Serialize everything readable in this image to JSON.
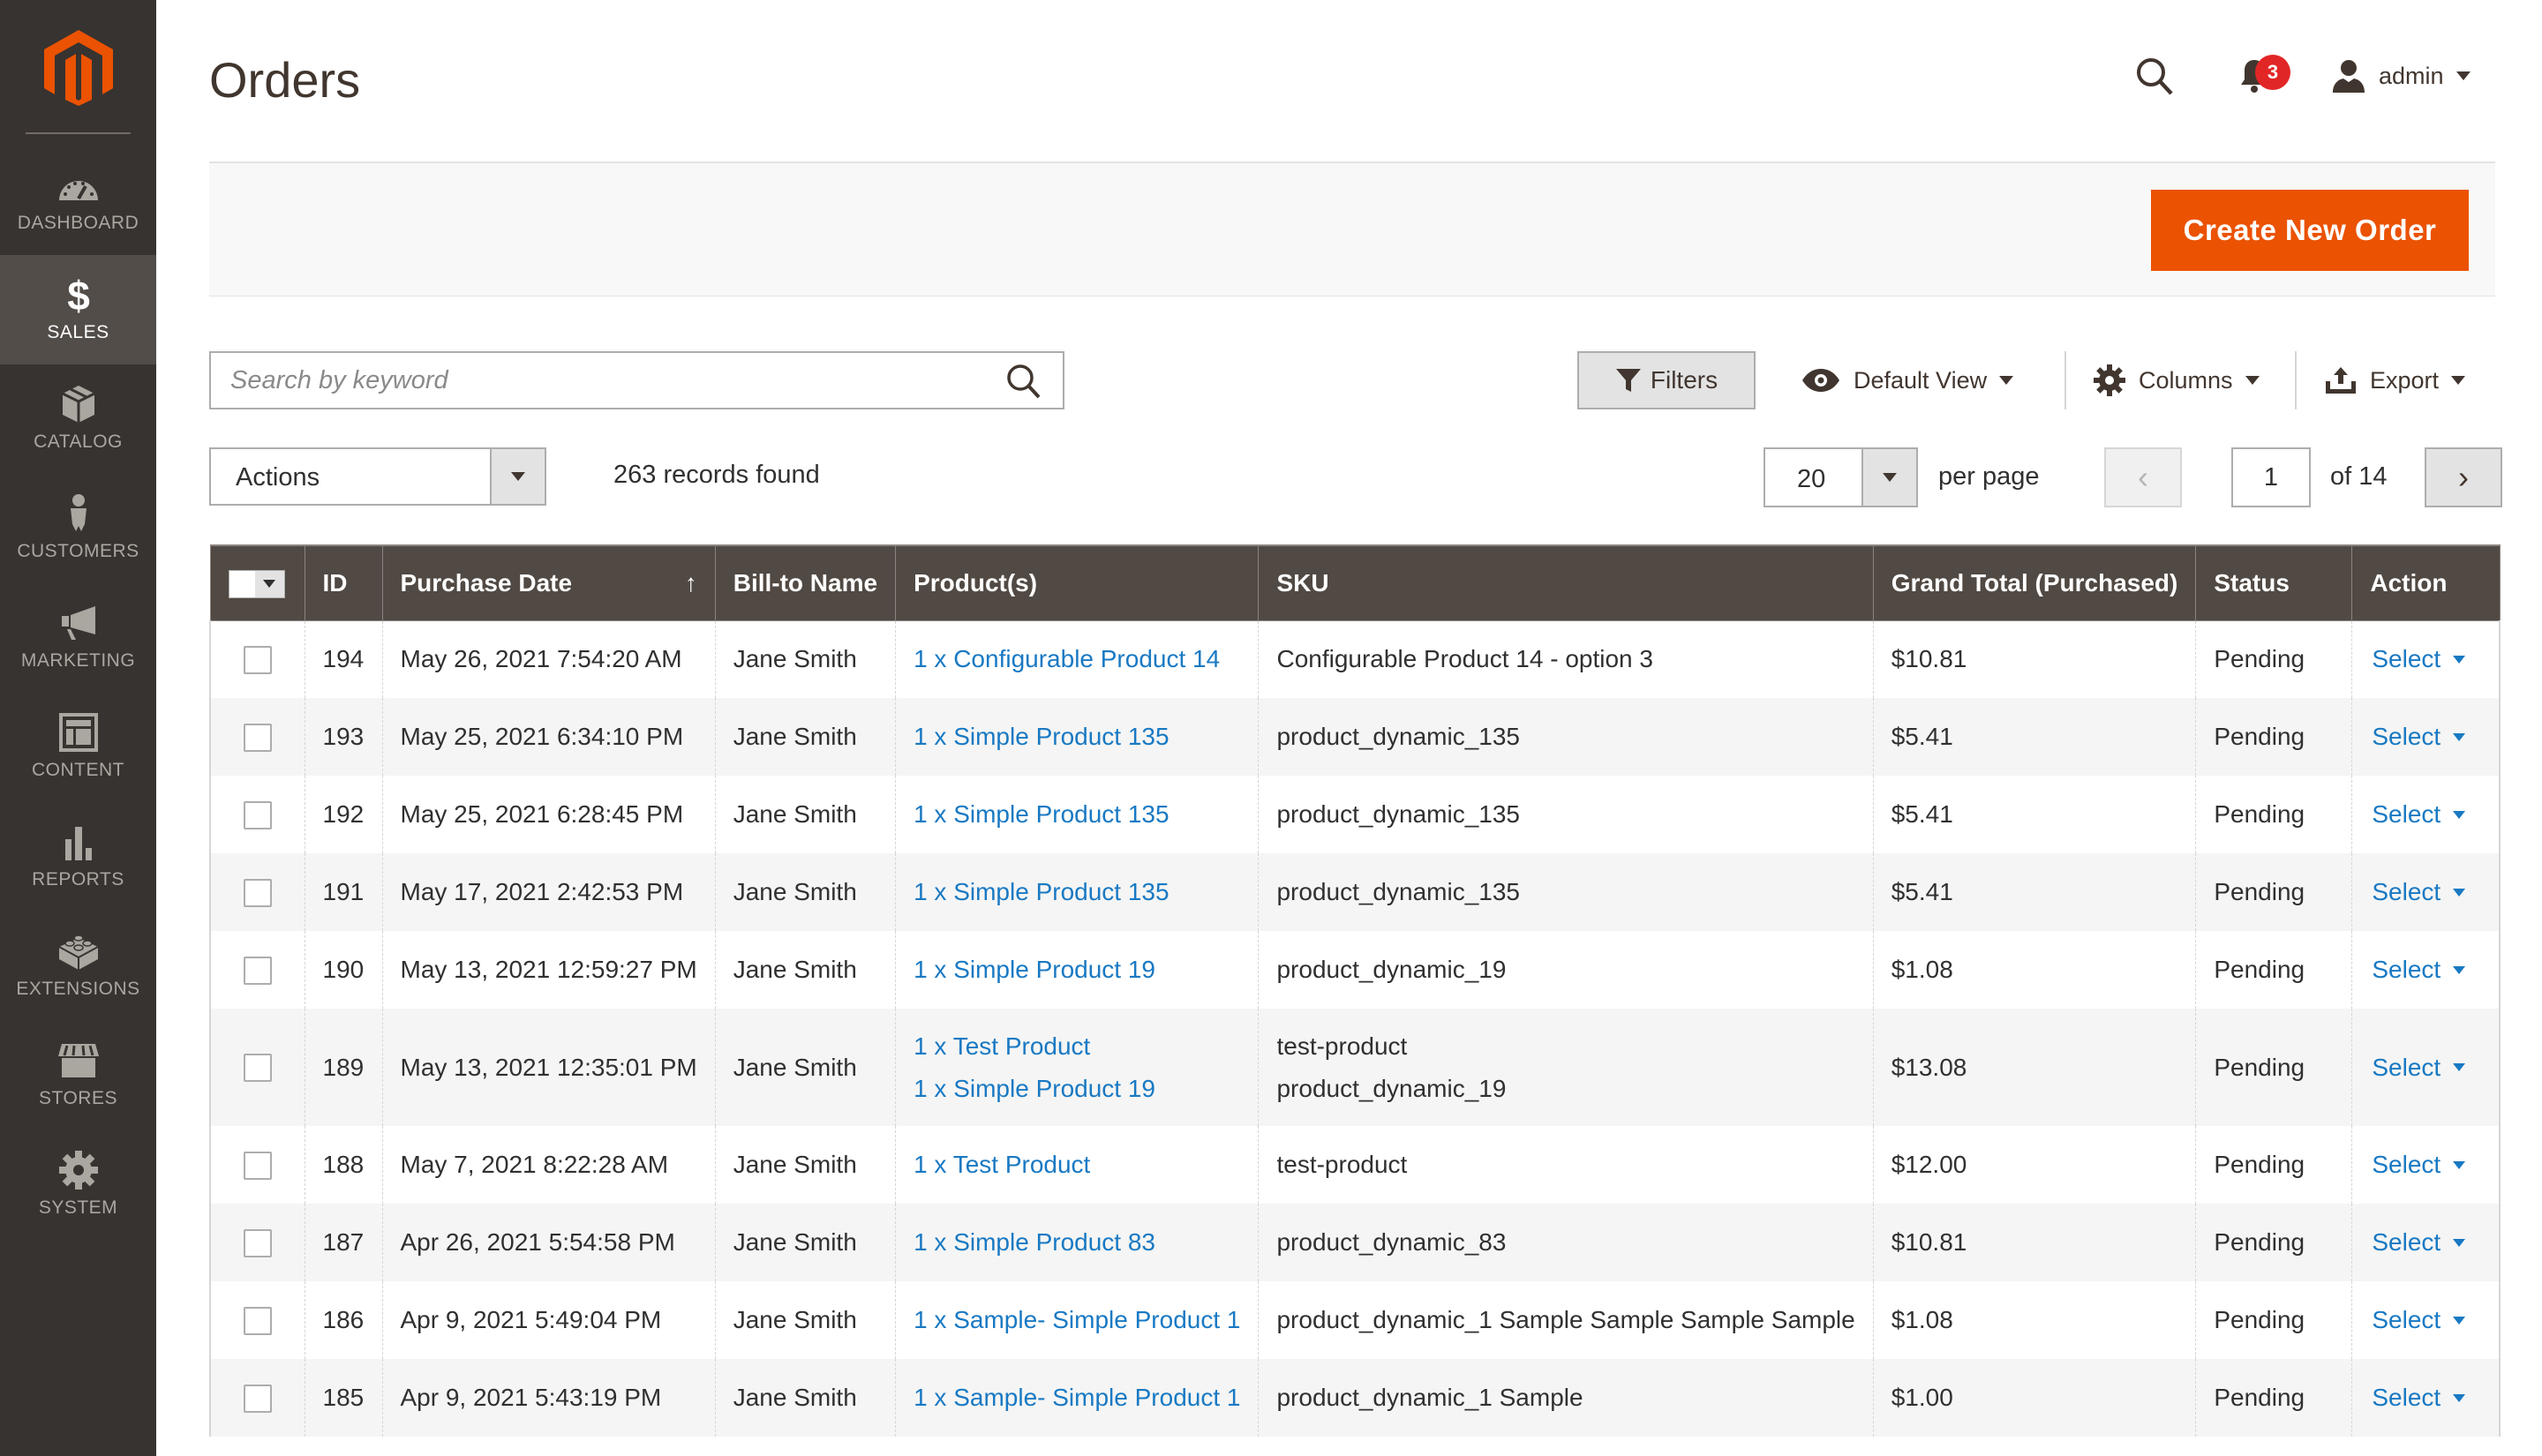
{
  "sidebar": {
    "logo": "magento-logo",
    "items": [
      {
        "label": "DASHBOARD",
        "icon": "dashboard-gauge-icon",
        "active": false
      },
      {
        "label": "SALES",
        "icon": "dollar-icon",
        "active": true
      },
      {
        "label": "CATALOG",
        "icon": "box-icon",
        "active": false
      },
      {
        "label": "CUSTOMERS",
        "icon": "person-icon",
        "active": false
      },
      {
        "label": "MARKETING",
        "icon": "megaphone-icon",
        "active": false
      },
      {
        "label": "CONTENT",
        "icon": "layout-icon",
        "active": false
      },
      {
        "label": "REPORTS",
        "icon": "bar-chart-icon",
        "active": false
      },
      {
        "label": "EXTENSIONS",
        "icon": "lego-brick-icon",
        "active": false
      },
      {
        "label": "STORES",
        "icon": "storefront-icon",
        "active": false
      },
      {
        "label": "SYSTEM",
        "icon": "gear-icon",
        "active": false
      }
    ]
  },
  "header": {
    "title": "Orders",
    "notifications_count": "3",
    "user": "admin"
  },
  "page_actions": {
    "create_button": "Create New Order"
  },
  "toolbar": {
    "search_placeholder": "Search by keyword",
    "search_value": "",
    "filters": "Filters",
    "view": "Default View",
    "columns": "Columns",
    "export": "Export",
    "actions": "Actions",
    "records_found": "263 records found",
    "per_page_value": "20",
    "per_page_label": "per page",
    "prev": "‹",
    "next": "›",
    "current_page": "1",
    "of_pages": "of 14"
  },
  "grid": {
    "columns": [
      "ID",
      "Purchase Date",
      "Bill-to Name",
      "Product(s)",
      "SKU",
      "Grand Total (Purchased)",
      "Status",
      "Action"
    ],
    "sort_indicator": "↑",
    "rows": [
      {
        "id": "194",
        "date": "May 26, 2021 7:54:20 AM",
        "name": "Jane Smith",
        "products": [
          "1 x Configurable Product 14"
        ],
        "skus": [
          "Configurable Product 14 - option 3"
        ],
        "total": "$10.81",
        "status": "Pending",
        "action": "Select"
      },
      {
        "id": "193",
        "date": "May 25, 2021 6:34:10 PM",
        "name": "Jane Smith",
        "products": [
          "1 x Simple Product 135"
        ],
        "skus": [
          "product_dynamic_135"
        ],
        "total": "$5.41",
        "status": "Pending",
        "action": "Select"
      },
      {
        "id": "192",
        "date": "May 25, 2021 6:28:45 PM",
        "name": "Jane Smith",
        "products": [
          "1 x Simple Product 135"
        ],
        "skus": [
          "product_dynamic_135"
        ],
        "total": "$5.41",
        "status": "Pending",
        "action": "Select"
      },
      {
        "id": "191",
        "date": "May 17, 2021 2:42:53 PM",
        "name": "Jane Smith",
        "products": [
          "1 x Simple Product 135"
        ],
        "skus": [
          "product_dynamic_135"
        ],
        "total": "$5.41",
        "status": "Pending",
        "action": "Select"
      },
      {
        "id": "190",
        "date": "May 13, 2021 12:59:27 PM",
        "name": "Jane Smith",
        "products": [
          "1 x Simple Product 19"
        ],
        "skus": [
          "product_dynamic_19"
        ],
        "total": "$1.08",
        "status": "Pending",
        "action": "Select"
      },
      {
        "id": "189",
        "date": "May 13, 2021 12:35:01 PM",
        "name": "Jane Smith",
        "products": [
          "1 x Test Product",
          "1 x Simple Product 19"
        ],
        "skus": [
          "test-product",
          "product_dynamic_19"
        ],
        "total": "$13.08",
        "status": "Pending",
        "action": "Select"
      },
      {
        "id": "188",
        "date": "May 7, 2021 8:22:28 AM",
        "name": "Jane Smith",
        "products": [
          "1 x Test Product"
        ],
        "skus": [
          "test-product"
        ],
        "total": "$12.00",
        "status": "Pending",
        "action": "Select"
      },
      {
        "id": "187",
        "date": "Apr 26, 2021 5:54:58 PM",
        "name": "Jane Smith",
        "products": [
          "1 x Simple Product 83"
        ],
        "skus": [
          "product_dynamic_83"
        ],
        "total": "$10.81",
        "status": "Pending",
        "action": "Select"
      },
      {
        "id": "186",
        "date": "Apr 9, 2021 5:49:04 PM",
        "name": "Jane Smith",
        "products": [
          "1 x Sample- Simple Product 1"
        ],
        "skus": [
          "product_dynamic_1 Sample Sample Sample Sample"
        ],
        "total": "$1.08",
        "status": "Pending",
        "action": "Select"
      },
      {
        "id": "185",
        "date": "Apr 9, 2021 5:43:19 PM",
        "name": "Jane Smith",
        "products": [
          "1 x Sample- Simple Product 1"
        ],
        "skus": [
          "product_dynamic_1 Sample"
        ],
        "total": "$1.00",
        "status": "Pending",
        "action": "Select"
      }
    ]
  },
  "colors": {
    "sidebar_bg": "#373330",
    "sidebar_active": "#524d49",
    "brand_orange": "#eb5202",
    "table_header": "#514943",
    "link_blue": "#1979c3",
    "badge_red": "#e22626"
  }
}
